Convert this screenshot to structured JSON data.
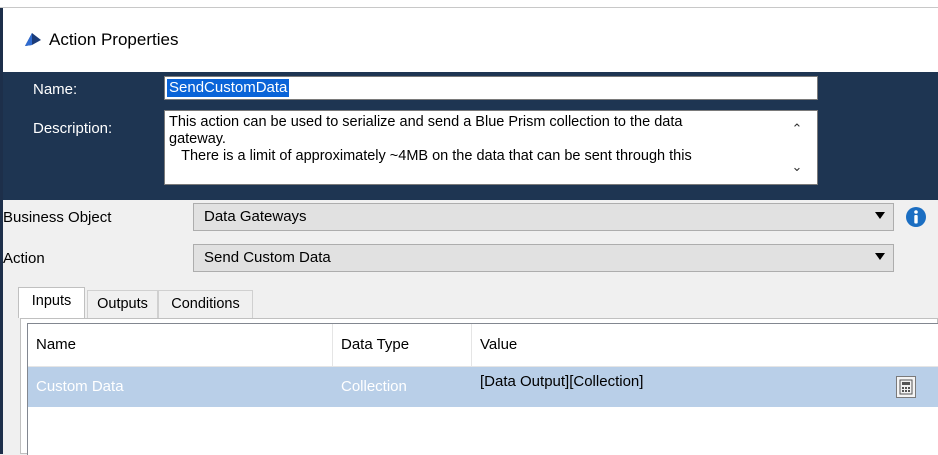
{
  "window": {
    "title": "Action Properties",
    "icon": "blue-prism-action-icon"
  },
  "header": {
    "name_label": "Name:",
    "name_value": "SendCustomData",
    "description_label": "Description:",
    "description_lines": [
      "This action can be used to serialize and send a Blue Prism collection to the data",
      "gateway.",
      "   There is a limit of approximately ~4MB on the data that can be sent through this"
    ]
  },
  "form": {
    "business_object_label": "Business Object",
    "business_object_value": "Data Gateways",
    "action_label": "Action",
    "action_value": "Send Custom Data"
  },
  "tabs": [
    {
      "label": "Inputs",
      "active": true
    },
    {
      "label": "Outputs",
      "active": false
    },
    {
      "label": "Conditions",
      "active": false
    }
  ],
  "grid": {
    "columns": [
      "Name",
      "Data Type",
      "Value"
    ],
    "rows": [
      {
        "name": "Custom Data",
        "data_type": "Collection",
        "value": "[Data Output][Collection]",
        "selected": true
      }
    ]
  },
  "colors": {
    "header_bg": "#1e3552",
    "selection_bg": "#0a64d8",
    "row_highlight": "#b9cfe8",
    "info_icon": "#1b6ec2"
  }
}
